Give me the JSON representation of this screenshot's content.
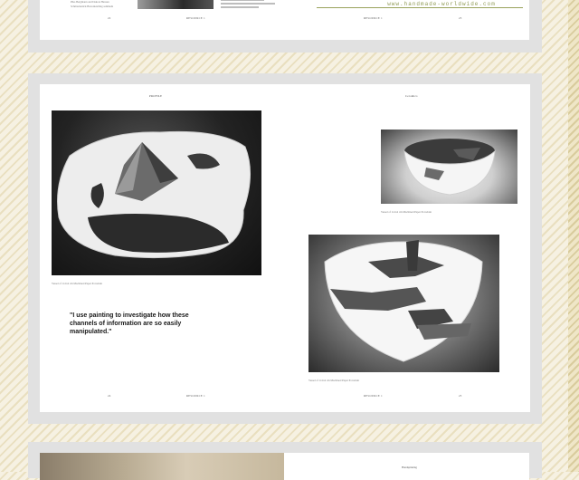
{
  "top_spread": {
    "credit_left": [
      "Pika Bergmann and Dakota Hansen",
      "Schmuckstück Bretonktelling sammeln"
    ],
    "website": "www.handmade-worldwide.com",
    "folio_left": "22",
    "running_left": "RESOURCE 1",
    "running_right": "RESOURCE 1",
    "folio_right": "23"
  },
  "spread": {
    "header_left": "PROFILE",
    "header_right": "Ceramics",
    "caption_left": "Vessel of 1x1x4 cm Machined Paper Porcelain",
    "caption_top_right": "Vessel of 1x1x4 cm Machined Paper Porcelain",
    "caption_bottom_right": "Vessel of 1x1x4 cm Machined Paper Porcelain",
    "quote": "\"I use painting to investigate how these channels of information are so easily manipulated.\"",
    "folio_left": "24",
    "running_left": "RESOURCE 1",
    "running_right": "RESOURCE 1",
    "folio_right": "25"
  },
  "bottom_spread": {
    "label": "Handspinning"
  }
}
